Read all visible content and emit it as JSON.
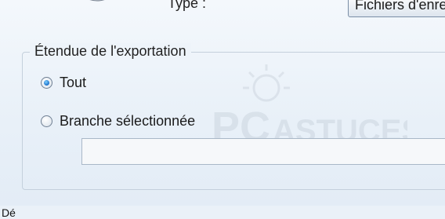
{
  "header": {
    "type_label": "Type :",
    "type_value": "Fichiers d'enregistrement (*.reg)"
  },
  "export_range": {
    "title": "Étendue de l'exportation",
    "options": [
      {
        "label": "Tout",
        "checked": true
      },
      {
        "label": "Branche sélectionnée",
        "checked": false
      }
    ],
    "branch_value": ""
  },
  "watermark": {
    "text_top": "PC",
    "text_bottom": "ASTUCES"
  },
  "footer": {
    "text": "Dé"
  },
  "icons": {
    "folder": "folder-icon"
  },
  "colors": {
    "accent": "#1a6fc9",
    "frame_border": "#c4d0dc",
    "background": "#eaf1f8"
  }
}
